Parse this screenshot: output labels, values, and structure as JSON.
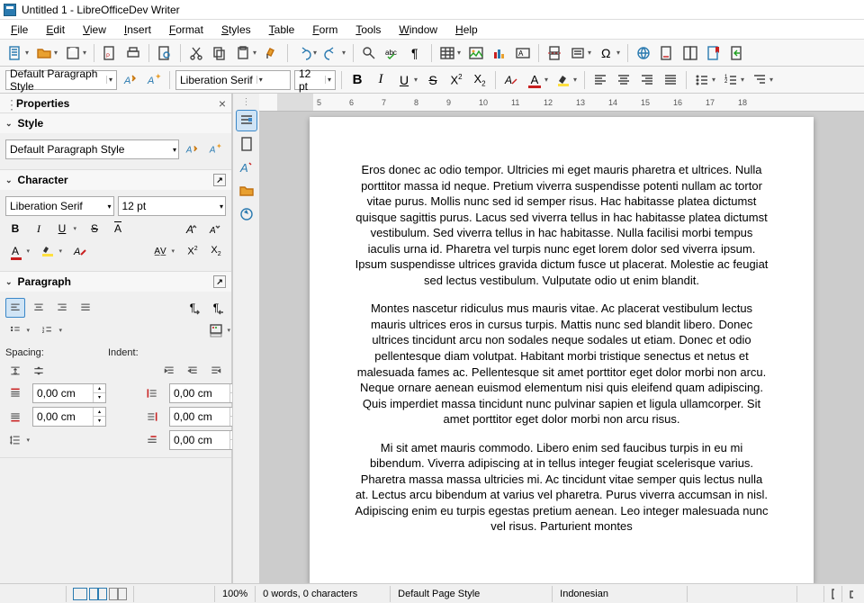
{
  "window": {
    "title": "Untitled 1 - LibreOfficeDev Writer"
  },
  "menu": [
    "File",
    "Edit",
    "View",
    "Insert",
    "Format",
    "Styles",
    "Table",
    "Form",
    "Tools",
    "Window",
    "Help"
  ],
  "format_bar": {
    "para_style": "Default Paragraph Style",
    "font_name": "Liberation Serif",
    "font_size": "12 pt"
  },
  "sidebar": {
    "title": "Properties",
    "style": {
      "title": "Style",
      "value": "Default Paragraph Style"
    },
    "character": {
      "title": "Character",
      "font_name": "Liberation Serif",
      "font_size": "12 pt"
    },
    "paragraph": {
      "title": "Paragraph",
      "spacing_label": "Spacing:",
      "indent_label": "Indent:",
      "above": "0,00 cm",
      "below": "0,00 cm",
      "left": "0,00 cm",
      "right": "0,00 cm",
      "first": "0,00 cm"
    }
  },
  "ruler": [
    "",
    "5",
    "6",
    "7",
    "8",
    "9",
    "10",
    "11",
    "12",
    "13",
    "14",
    "15",
    "16",
    "17",
    "18"
  ],
  "document": {
    "p1": "Eros donec ac odio tempor. Ultricies mi eget mauris pharetra et ultrices. Nulla porttitor massa id neque. Pretium viverra suspendisse potenti nullam ac tortor vitae purus. Mollis nunc sed id semper risus. Hac habitasse platea dictumst quisque sagittis purus. Lacus sed viverra tellus in hac habitasse platea dictumst vestibulum. Sed viverra tellus in hac habitasse. Nulla facilisi morbi tempus iaculis urna id. Pharetra vel turpis nunc eget lorem dolor sed viverra ipsum. Ipsum suspendisse ultrices gravida dictum fusce ut placerat. Molestie ac feugiat sed lectus vestibulum. Vulputate odio ut enim blandit.",
    "p2": "Montes nascetur ridiculus mus mauris vitae. Ac placerat vestibulum lectus mauris ultrices eros in cursus turpis. Mattis nunc sed blandit libero. Donec ultrices tincidunt arcu non sodales neque sodales ut etiam. Donec et odio pellentesque diam volutpat. Habitant morbi tristique senectus et netus et malesuada fames ac. Pellentesque sit amet porttitor eget dolor morbi non arcu. Neque ornare aenean euismod elementum nisi quis eleifend quam adipiscing. Quis imperdiet massa tincidunt nunc pulvinar sapien et ligula ullamcorper. Sit amet porttitor eget dolor morbi non arcu risus.",
    "p3": "Mi sit amet mauris commodo. Libero enim sed faucibus turpis in eu mi bibendum. Viverra adipiscing at in tellus integer feugiat scelerisque varius. Pharetra massa massa ultricies mi. Ac tincidunt vitae semper quis lectus nulla at. Lectus arcu bibendum at varius vel pharetra. Purus viverra accumsan in nisl. Adipiscing enim eu turpis egestas pretium aenean. Leo integer malesuada nunc vel risus. Parturient montes"
  },
  "status": {
    "zoom": "100%",
    "words": "0 words, 0 characters",
    "page_style": "Default Page Style",
    "lang": "Indonesian"
  }
}
